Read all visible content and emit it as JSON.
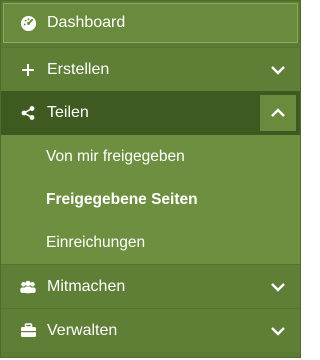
{
  "menu": {
    "items": [
      {
        "label": "Dashboard",
        "icon": "dashboard-gauge-icon"
      },
      {
        "label": "Erstellen",
        "icon": "plus-icon"
      },
      {
        "label": "Teilen",
        "icon": "share-icon"
      },
      {
        "label": "Mitmachen",
        "icon": "users-icon"
      },
      {
        "label": "Verwalten",
        "icon": "briefcase-icon"
      }
    ],
    "teilen_sub": [
      {
        "label": "Von mir freigegeben"
      },
      {
        "label": "Freigegebene Seiten"
      },
      {
        "label": "Einreichungen"
      }
    ]
  },
  "colors": {
    "menu_bg": "#5c7a34",
    "active_bg": "#3f5a21",
    "submenu_bg": "#6e8f40",
    "text": "#ffffff"
  }
}
